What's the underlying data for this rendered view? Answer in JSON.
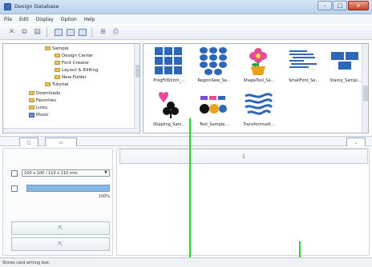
{
  "window": {
    "title": "Design Database"
  },
  "menu": [
    "File",
    "Edit",
    "Display",
    "Option",
    "Help"
  ],
  "tree": [
    {
      "label": "Sample",
      "indent": 3,
      "type": "folder"
    },
    {
      "label": "Design Center",
      "indent": 4,
      "type": "folder"
    },
    {
      "label": "Font Creator",
      "indent": 4,
      "type": "folder"
    },
    {
      "label": "Layout & Editing",
      "indent": 4,
      "type": "folder"
    },
    {
      "label": "New Folder",
      "indent": 4,
      "type": "folder"
    },
    {
      "label": "Tutorial",
      "indent": 3,
      "type": "folder"
    },
    {
      "label": "Downloads",
      "indent": 1,
      "type": "folder"
    },
    {
      "label": "Favorites",
      "indent": 1,
      "type": "folder"
    },
    {
      "label": "Links",
      "indent": 1,
      "type": "folder"
    },
    {
      "label": "Music",
      "indent": 1,
      "type": "lib"
    }
  ],
  "thumbnails": [
    {
      "label": "ProgFillStitch_...",
      "icon": "grid-pattern-icon"
    },
    {
      "label": "RegionSew_Sa...",
      "icon": "dot-pattern-icon"
    },
    {
      "label": "ShapeTool_Sa...",
      "icon": "flower-pot-icon"
    },
    {
      "label": "SmallFont_Sa...",
      "icon": "small-text-icon"
    },
    {
      "label": "Stamp_Sampl...",
      "icon": "stamp-blocks-icon"
    },
    {
      "label": "Stippling_Sam...",
      "icon": "heart-club-icon"
    },
    {
      "label": "Text_Sample...",
      "icon": "abc-text-icon"
    },
    {
      "label": "TransformLett...",
      "icon": "wavy-lines-icon"
    }
  ],
  "toolbar": {
    "buttons": [
      "delete-icon",
      "copy-icon",
      "paste-icon",
      "large-view-icon",
      "medium-view-icon",
      "small-view-icon",
      "list-view-icon",
      "print-icon"
    ]
  },
  "tabs": [
    "◻",
    "▭"
  ],
  "panel": {
    "collapse_button": "⇓",
    "size_select": "100 x 100 / 110 x 110 mm",
    "progress": 1.0,
    "progress_label": "100%",
    "import_button": "⇱",
    "open_button": "⇱"
  },
  "status": {
    "text": "Stores card writing box."
  },
  "colors": {
    "accent": "#22d62b",
    "thumbnail_blue": "#2f67b8",
    "thumbnail_dark": "#153568",
    "flower_pink": "#e84b98"
  }
}
